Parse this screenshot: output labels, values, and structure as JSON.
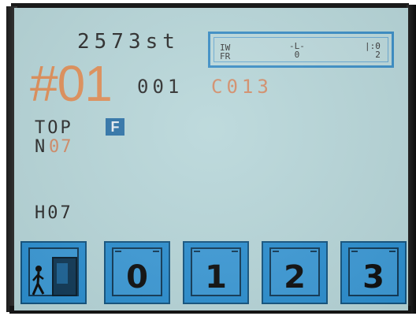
{
  "display": {
    "stitch_count": "2573st",
    "pattern_number": "#01",
    "program_number": "001",
    "code_value": "C013",
    "status_panel": {
      "left_glyphs": "IW\nFR",
      "middle_glyphs": "-L-\n 0",
      "right_glyphs": "|:0\n  2"
    },
    "top_label": "TOP",
    "mode_badge": "F",
    "n_prefix": "N",
    "n_digits": "07",
    "h_value": "H07"
  },
  "softkeys": [
    {
      "name": "exit",
      "icon": "exit-door-icon"
    },
    {
      "name": "zero",
      "label": "0"
    },
    {
      "name": "one",
      "label": "1"
    },
    {
      "name": "two",
      "label": "2"
    },
    {
      "name": "three",
      "label": "3"
    }
  ],
  "colors": {
    "screen_bg": "#b7d6d9",
    "accent_orange": "#e0905a",
    "key_blue": "#2c8fd0",
    "text_dark": "#2c2c2c"
  }
}
